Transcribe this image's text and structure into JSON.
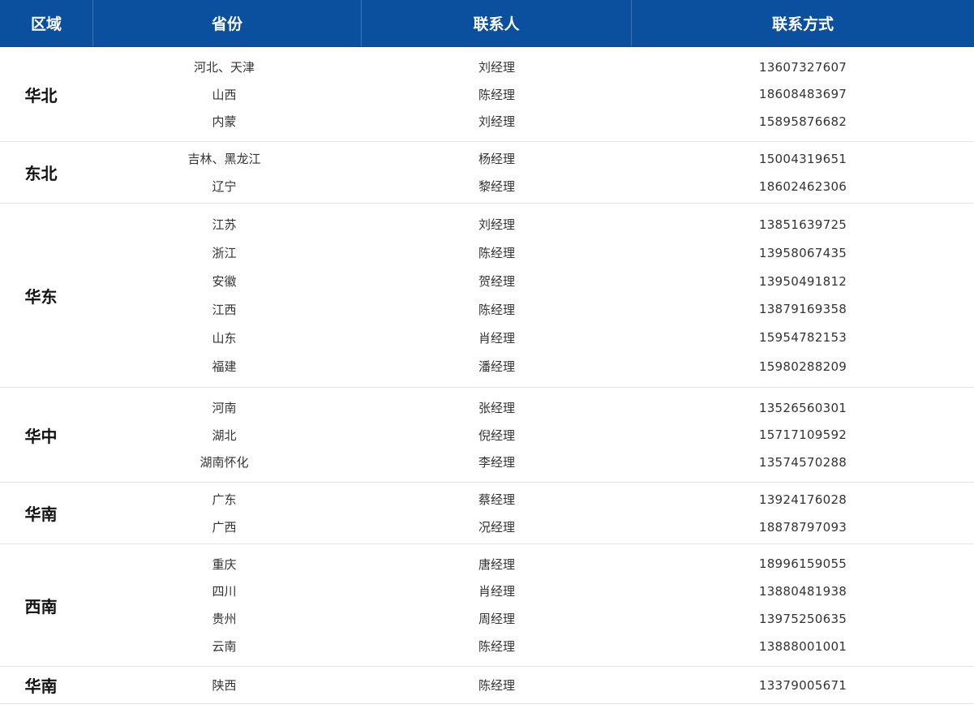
{
  "headers": {
    "region": "区域",
    "province": "省份",
    "contact": "联系人",
    "phone": "联系方式"
  },
  "groups": [
    {
      "region": "华北",
      "rows": [
        {
          "province": "河北、天津",
          "contact": "刘经理",
          "phone": "13607327607"
        },
        {
          "province": "山西",
          "contact": "陈经理",
          "phone": "18608483697"
        },
        {
          "province": "内蒙",
          "contact": "刘经理",
          "phone": "15895876682"
        }
      ]
    },
    {
      "region": "东北",
      "rows": [
        {
          "province": "吉林、黑龙江",
          "contact": "杨经理",
          "phone": "15004319651"
        },
        {
          "province": "辽宁",
          "contact": "黎经理",
          "phone": "18602462306"
        }
      ]
    },
    {
      "region": "华东",
      "rows": [
        {
          "province": "江苏",
          "contact": "刘经理",
          "phone": "13851639725"
        },
        {
          "province": "浙江",
          "contact": "陈经理",
          "phone": "13958067435"
        },
        {
          "province": "安徽",
          "contact": "贺经理",
          "phone": "13950491812"
        },
        {
          "province": "江西",
          "contact": "陈经理",
          "phone": "13879169358"
        },
        {
          "province": "山东",
          "contact": "肖经理",
          "phone": "15954782153"
        },
        {
          "province": "福建",
          "contact": "潘经理",
          "phone": "15980288209"
        }
      ]
    },
    {
      "region": "华中",
      "rows": [
        {
          "province": "河南",
          "contact": "张经理",
          "phone": "13526560301"
        },
        {
          "province": "湖北",
          "contact": "倪经理",
          "phone": "15717109592"
        },
        {
          "province": "湖南怀化",
          "contact": "李经理",
          "phone": "13574570288"
        }
      ]
    },
    {
      "region": "华南",
      "rows": [
        {
          "province": "广东",
          "contact": "蔡经理",
          "phone": "13924176028"
        },
        {
          "province": "广西",
          "contact": "况经理",
          "phone": "18878797093"
        }
      ]
    },
    {
      "region": "西南",
      "rows": [
        {
          "province": "重庆",
          "contact": "唐经理",
          "phone": "18996159055"
        },
        {
          "province": "四川",
          "contact": "肖经理",
          "phone": "13880481938"
        },
        {
          "province": "贵州",
          "contact": "周经理",
          "phone": "13975250635"
        },
        {
          "province": "云南",
          "contact": "陈经理",
          "phone": "13888001001"
        }
      ]
    },
    {
      "region": "华南",
      "rows": [
        {
          "province": "陕西",
          "contact": "陈经理",
          "phone": "13379005671"
        }
      ]
    }
  ],
  "colors": {
    "header_bg": "#0b4f9f",
    "header_text": "#ffffff",
    "divider": "#e3e3e3"
  }
}
